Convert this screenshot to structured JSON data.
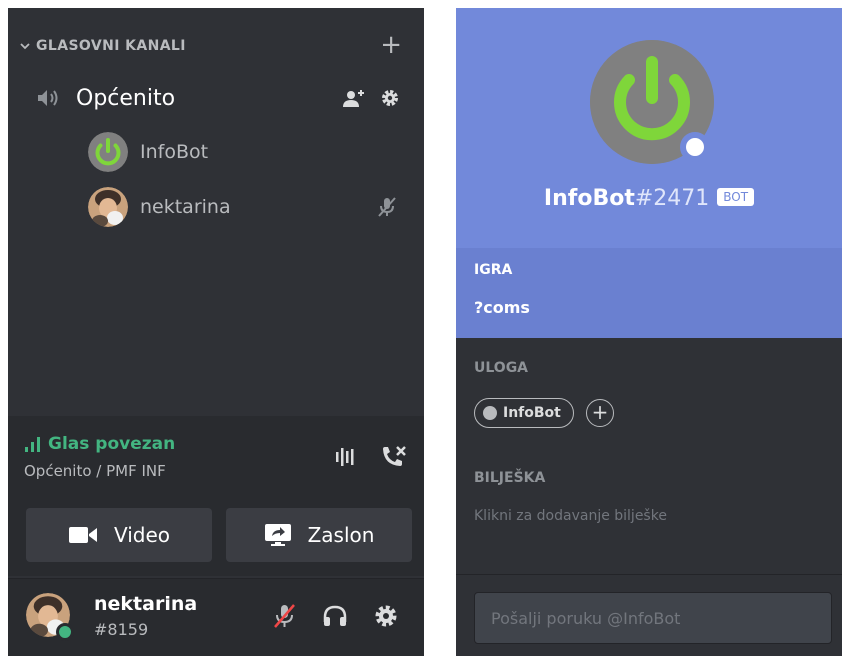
{
  "sidebar": {
    "category": {
      "label": "GLASOVNI KANALI",
      "add_icon": "plus-icon"
    },
    "channel": {
      "name": "Općenito",
      "icon": "speaker-icon",
      "actions": [
        "add-user-icon",
        "gear-icon"
      ]
    },
    "voice_users": [
      {
        "name": "InfoBot",
        "avatar": "power-icon-avatar",
        "muted": false
      },
      {
        "name": "nektarina",
        "avatar": "photo-avatar",
        "muted": true
      }
    ]
  },
  "voice_connection": {
    "status": "Glas povezan",
    "location": "Općenito / PMF INF",
    "status_color": "#43b581",
    "video_label": "Video",
    "screen_label": "Zaslon"
  },
  "user_panel": {
    "name": "nektarina",
    "tag": "#8159",
    "status_color": "#43b581"
  },
  "profile": {
    "name": "InfoBot",
    "discriminator": "#2471",
    "badge": "BOT",
    "accent_color": "#7289da",
    "game_label": "IGRA",
    "game_value": "?coms",
    "roles_label": "ULOGA",
    "role": "InfoBot",
    "note_label": "BILJEŠKA",
    "note_placeholder": "Klikni za dodavanje bilješke",
    "message_placeholder": "Pošalji poruku @InfoBot"
  }
}
